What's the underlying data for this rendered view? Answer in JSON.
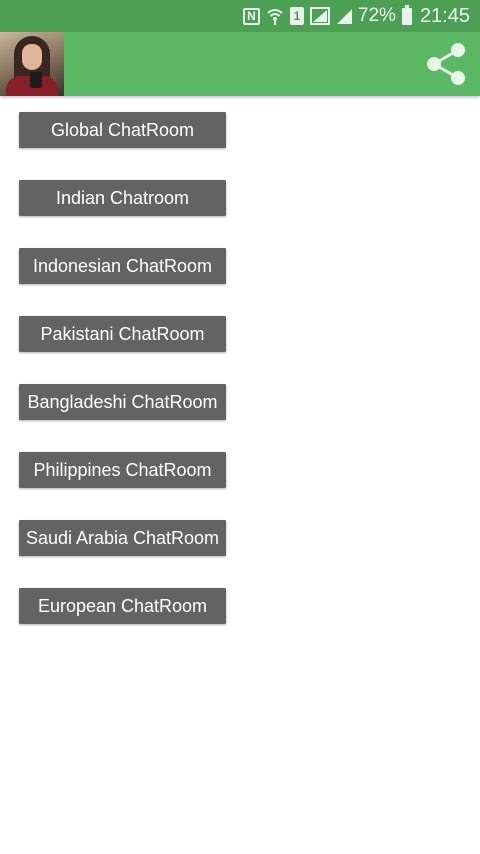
{
  "status_bar": {
    "battery_percent": "72%",
    "time": "21:45",
    "sim_label": "1",
    "nfc_label": "N",
    "icons": [
      "nfc-icon",
      "wifi-icon",
      "sim-icon",
      "signal-icon",
      "signal-icon",
      "battery-icon"
    ]
  },
  "app_bar": {
    "avatar": "profile-photo",
    "share_icon": "share-icon",
    "colors": {
      "status_bar": "#4c9f55",
      "app_bar": "#5cb865",
      "button": "#636363"
    }
  },
  "chat_rooms": [
    {
      "label": "Global ChatRoom"
    },
    {
      "label": "Indian Chatroom"
    },
    {
      "label": "Indonesian ChatRoom"
    },
    {
      "label": "Pakistani ChatRoom"
    },
    {
      "label": "Bangladeshi ChatRoom"
    },
    {
      "label": "Philippines ChatRoom"
    },
    {
      "label": "Saudi Arabia ChatRoom"
    },
    {
      "label": "European ChatRoom"
    }
  ]
}
